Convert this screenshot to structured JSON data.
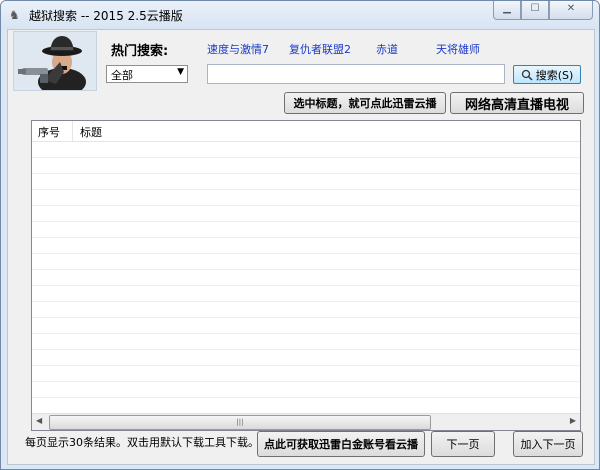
{
  "window": {
    "title": "越狱搜索 -- 2015 2.5云播版",
    "controls": [
      "minimize",
      "maximize",
      "close"
    ]
  },
  "search": {
    "hot_label": "热门搜索:",
    "hot_links": [
      "速度与激情7",
      "复仇者联盟2",
      "赤道",
      "天将雄师"
    ],
    "category_selected": "全部",
    "query": "",
    "button_label": "搜索(S)",
    "button_icon": "magnifier-icon"
  },
  "toolbar": {
    "tip_button": "选中标题，就可点此迅雷云播",
    "tv_button": "网络高清直播电视"
  },
  "results": {
    "columns": [
      "序号",
      "标题"
    ],
    "rows": []
  },
  "footer": {
    "status": "每页显示30条结果。双击用默认下载工具下载。",
    "account_button": "点此可获取迅雷白金账号看云播",
    "next_button": "下一页",
    "add_next_button": "加入下一页"
  },
  "colors": {
    "link": "#1b3ac5",
    "titlebar": "#d7e4f2",
    "window_bg": "#f0f0f0"
  }
}
